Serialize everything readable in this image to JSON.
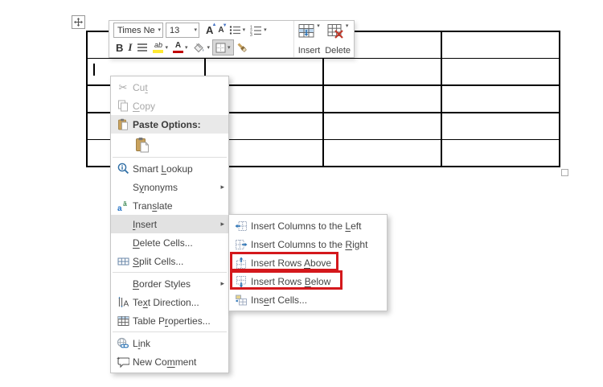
{
  "colors": {
    "annotation_red": "#d4181c",
    "accent_blue": "#2e75b6",
    "menu_highlight": "#e2e2e2",
    "table_border": "#000000",
    "highlight_yellow": "#ffe933",
    "font_color_red": "#c00000"
  },
  "table": {
    "rows": 5,
    "cols": 4
  },
  "mini_toolbar": {
    "font_name_value": "Times Ne",
    "font_size_value": "13",
    "grow_font_label": "A",
    "shrink_font_label": "A",
    "bold_label": "B",
    "italic_label": "I",
    "highlight_label": "ab",
    "font_color_label": "A",
    "insert_button_label": "Insert",
    "delete_button_label": "Delete"
  },
  "icons": {
    "dropdown_arrow": "▾",
    "submenu_arrow": "▸",
    "scissors_glyph": "✂",
    "caret_up": "▲",
    "caret_down": "▼"
  },
  "context_menu": {
    "items": [
      {
        "pre": "Cu",
        "key": "t",
        "post": ""
      },
      {
        "pre": "",
        "key": "C",
        "post": "opy"
      },
      {
        "label": "Paste Options:"
      },
      {
        "pre": "Smart ",
        "key": "L",
        "post": "ookup"
      },
      {
        "pre": "S",
        "key": "y",
        "post": "nonyms"
      },
      {
        "pre": "Tran",
        "key": "s",
        "post": "late"
      },
      {
        "pre": "",
        "key": "I",
        "post": "nsert"
      },
      {
        "pre": "",
        "key": "D",
        "post": "elete Cells..."
      },
      {
        "pre": "",
        "key": "S",
        "post": "plit Cells..."
      },
      {
        "pre": "",
        "key": "B",
        "post": "order Styles"
      },
      {
        "pre": "Te",
        "key": "x",
        "post": "t Direction..."
      },
      {
        "pre": "Table P",
        "key": "r",
        "post": "operties..."
      },
      {
        "pre": "L",
        "key": "i",
        "post": "nk"
      },
      {
        "pre": "New Co",
        "key": "m",
        "post": "ment"
      }
    ]
  },
  "submenu": {
    "items": [
      {
        "pre": "Insert Columns to the ",
        "key": "L",
        "post": "eft"
      },
      {
        "pre": "Insert Columns to the ",
        "key": "R",
        "post": "ight"
      },
      {
        "pre": "Insert Rows ",
        "key": "A",
        "post": "bove"
      },
      {
        "pre": "Insert Rows ",
        "key": "B",
        "post": "elow"
      },
      {
        "pre": "Ins",
        "key": "e",
        "post": "rt Cells..."
      }
    ]
  }
}
